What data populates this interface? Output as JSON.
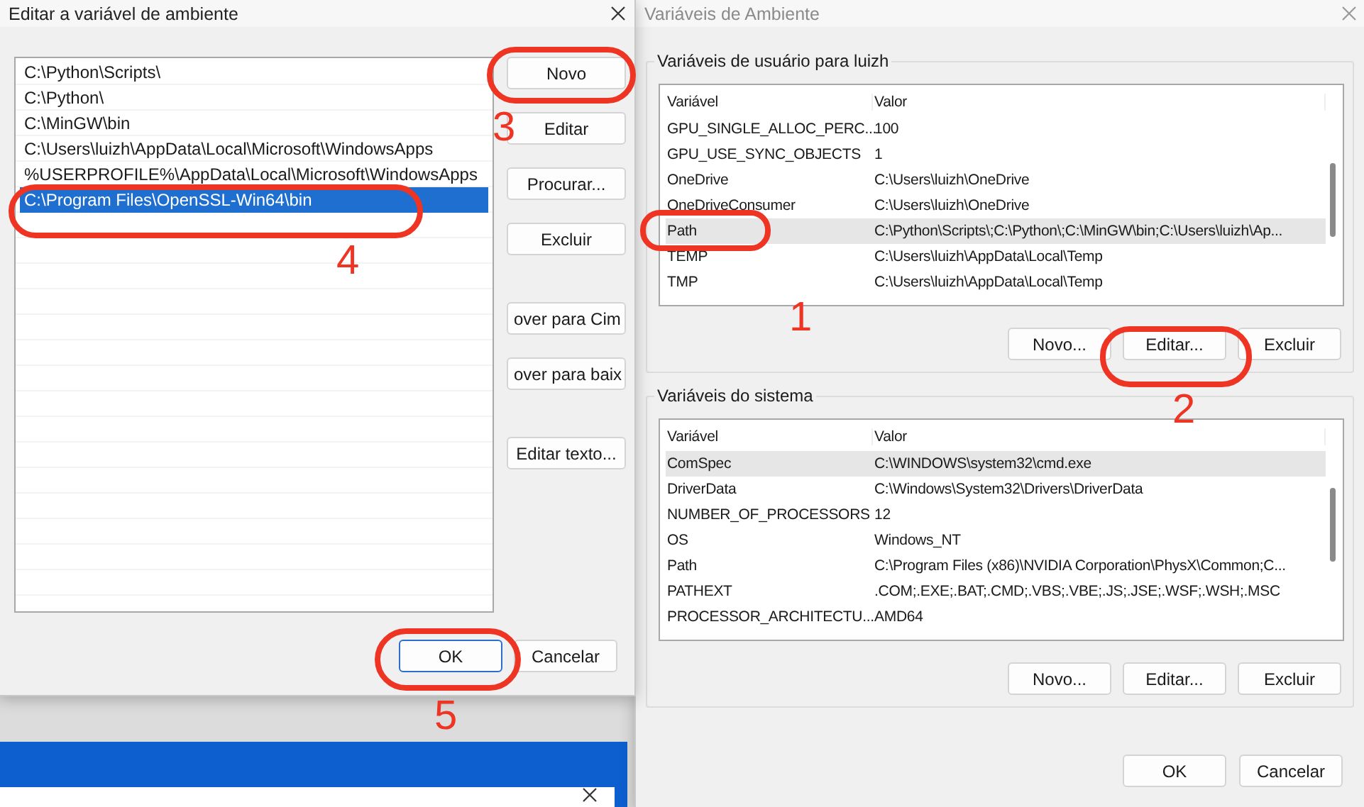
{
  "edit_dialog": {
    "title": "Editar a variável de ambiente",
    "entries": [
      {
        "text": "C:\\Python\\Scripts\\",
        "selected": false
      },
      {
        "text": "C:\\Python\\",
        "selected": false
      },
      {
        "text": "C:\\MinGW\\bin",
        "selected": false
      },
      {
        "text": "C:\\Users\\luizh\\AppData\\Local\\Microsoft\\WindowsApps",
        "selected": false
      },
      {
        "text": "%USERPROFILE%\\AppData\\Local\\Microsoft\\WindowsApps",
        "selected": false
      },
      {
        "text": "C:\\Program Files\\OpenSSL-Win64\\bin",
        "selected": true
      }
    ],
    "button_groups": [
      [
        "Novo",
        "Editar",
        "Procurar...",
        "Excluir"
      ],
      [
        "over para Cim",
        "over para baix"
      ],
      [
        "Editar texto..."
      ]
    ],
    "footer_buttons": [
      {
        "label": "OK",
        "default": true
      },
      {
        "label": "Cancelar",
        "default": false
      }
    ]
  },
  "env_dialog": {
    "title": "Variáveis de Ambiente",
    "sections": [
      {
        "title": "Variáveis de usuário para luizh",
        "columns": [
          "Variável",
          "Valor"
        ],
        "rows": [
          {
            "name": "GPU_SINGLE_ALLOC_PERC...",
            "value": "100",
            "selected": false
          },
          {
            "name": "GPU_USE_SYNC_OBJECTS",
            "value": "1",
            "selected": false
          },
          {
            "name": "OneDrive",
            "value": "C:\\Users\\luizh\\OneDrive",
            "selected": false
          },
          {
            "name": "OneDriveConsumer",
            "value": "C:\\Users\\luizh\\OneDrive",
            "selected": false
          },
          {
            "name": "Path",
            "value": "C:\\Python\\Scripts\\;C:\\Python\\;C:\\MinGW\\bin;C:\\Users\\luizh\\Ap...",
            "selected": true
          },
          {
            "name": "TEMP",
            "value": "C:\\Users\\luizh\\AppData\\Local\\Temp",
            "selected": false
          },
          {
            "name": "TMP",
            "value": "C:\\Users\\luizh\\AppData\\Local\\Temp",
            "selected": false
          }
        ],
        "buttons": [
          "Novo...",
          "Editar...",
          "Excluir"
        ]
      },
      {
        "title": "Variáveis do sistema",
        "columns": [
          "Variável",
          "Valor"
        ],
        "rows": [
          {
            "name": "ComSpec",
            "value": "C:\\WINDOWS\\system32\\cmd.exe",
            "selected": true
          },
          {
            "name": "DriverData",
            "value": "C:\\Windows\\System32\\Drivers\\DriverData",
            "selected": false
          },
          {
            "name": "NUMBER_OF_PROCESSORS",
            "value": "12",
            "selected": false
          },
          {
            "name": "OS",
            "value": "Windows_NT",
            "selected": false
          },
          {
            "name": "Path",
            "value": "C:\\Program Files (x86)\\NVIDIA Corporation\\PhysX\\Common;C...",
            "selected": false
          },
          {
            "name": "PATHEXT",
            "value": ".COM;.EXE;.BAT;.CMD;.VBS;.VBE;.JS;.JSE;.WSF;.WSH;.MSC",
            "selected": false
          },
          {
            "name": "PROCESSOR_ARCHITECTU...",
            "value": "AMD64",
            "selected": false
          }
        ],
        "buttons": [
          "Novo...",
          "Editar...",
          "Excluir"
        ]
      }
    ],
    "footer_buttons": [
      "OK",
      "Cancelar"
    ]
  },
  "annotations": [
    "1",
    "2",
    "3",
    "4",
    "5"
  ]
}
